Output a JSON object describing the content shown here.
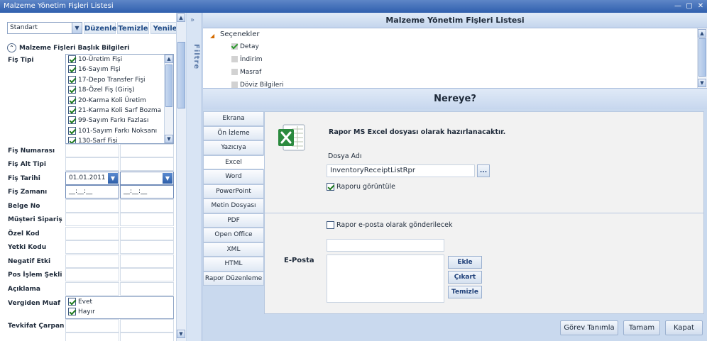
{
  "window": {
    "title": "Malzeme Yönetim Fişleri Listesi",
    "controls": [
      "—",
      "▢",
      "✕"
    ]
  },
  "left": {
    "combo_value": "Standart",
    "toolbar": [
      "Düzenle",
      "Temizle",
      "Yenile"
    ],
    "section_title": "Malzeme Fişleri Başlık Bilgileri",
    "fis_tipi_label": "Fiş Tipi",
    "fis_tipi_items": [
      {
        "label": "10-Üretim Fişi",
        "checked": true
      },
      {
        "label": "16-Sayım Fişi",
        "checked": true
      },
      {
        "label": "17-Depo Transfer Fişi",
        "checked": true
      },
      {
        "label": "18-Özel Fiş (Giriş)",
        "checked": true
      },
      {
        "label": "20-Karma Koli Üretim",
        "checked": true
      },
      {
        "label": "21-Karma Koli Sarf Bozma",
        "checked": true
      },
      {
        "label": "99-Sayım Farkı Fazlası",
        "checked": true
      },
      {
        "label": "101-Sayım Farkı Noksanı",
        "checked": true
      },
      {
        "label": "130-Sarf Fişi",
        "checked": true
      }
    ],
    "fields": [
      "Fiş Numarası",
      "Fiş Alt Tipi",
      "Fiş Tarihi",
      "Fiş Zamanı",
      "Belge No",
      "Müşteri Sipariş No",
      "Özel Kod",
      "Yetki Kodu",
      "Negatif Etki",
      "Pos İşlem Şekli",
      "Açıklama",
      "Vergiden Muaf",
      "Tevkifat Çarpan"
    ],
    "fis_tarihi_value": "01.01.2011",
    "fis_zamani_mask": "__:__:__",
    "vergiden_muaf_options": [
      {
        "label": "Evet",
        "checked": true
      },
      {
        "label": "Hayır",
        "checked": true
      }
    ]
  },
  "filter_label": "Filtre",
  "right": {
    "header": "Malzeme Yönetim Fişleri Listesi",
    "tree_root": "Seçenekler",
    "tree_items": [
      {
        "label": "Detay",
        "checked": true
      },
      {
        "label": "İndirim",
        "checked": false
      },
      {
        "label": "Masraf",
        "checked": false
      },
      {
        "label": "Döviz Bilgileri",
        "checked": false
      }
    ]
  },
  "dialog": {
    "title": "Nereye?",
    "tabs": [
      "Ekrana",
      "Ön İzleme",
      "Yazıcıya",
      "Excel",
      "Word",
      "PowerPoint",
      "Metin Dosyası",
      "PDF",
      "Open Office",
      "XML",
      "HTML",
      "Rapor Düzenleme"
    ],
    "active_tab": "Excel",
    "info_text": "Rapor MS Excel dosyası olarak hazırlanacaktır.",
    "file_label": "Dosya Adı",
    "file_value": "InventoryReceiptListRpr",
    "browse_label": "...",
    "view_report_label": "Raporu görüntüle",
    "view_report_checked": true,
    "email_checkbox_label": "Rapor e-posta olarak gönderilecek",
    "email_checked": false,
    "email_label": "E-Posta",
    "email_buttons": [
      "Ekle",
      "Çıkart",
      "Temizle"
    ],
    "footer_buttons": [
      "Görev Tanımla",
      "Tamam",
      "Kapat"
    ]
  }
}
